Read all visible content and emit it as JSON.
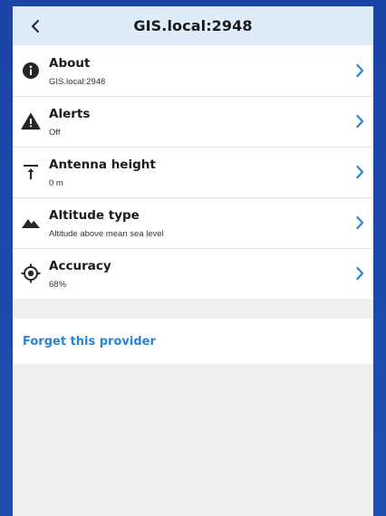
{
  "header": {
    "title": "GIS.local:2948",
    "back_icon": "chevron-left-icon"
  },
  "items": [
    {
      "icon": "info-icon",
      "title": "About",
      "subtitle": "GIS.local:2948"
    },
    {
      "icon": "warning-icon",
      "title": "Alerts",
      "subtitle": "Off"
    },
    {
      "icon": "antenna-height-icon",
      "title": "Antenna height",
      "subtitle": "0 m"
    },
    {
      "icon": "mountain-icon",
      "title": "Altitude type",
      "subtitle": "Altitude above mean sea level"
    },
    {
      "icon": "crosshair-icon",
      "title": "Accuracy",
      "subtitle": "68%"
    }
  ],
  "actions": {
    "forget_label": "Forget this provider"
  },
  "colors": {
    "header_bg": "#deebf9",
    "accent": "#2a84cf",
    "background": "#efefef",
    "frame": "#1e4fb0"
  }
}
